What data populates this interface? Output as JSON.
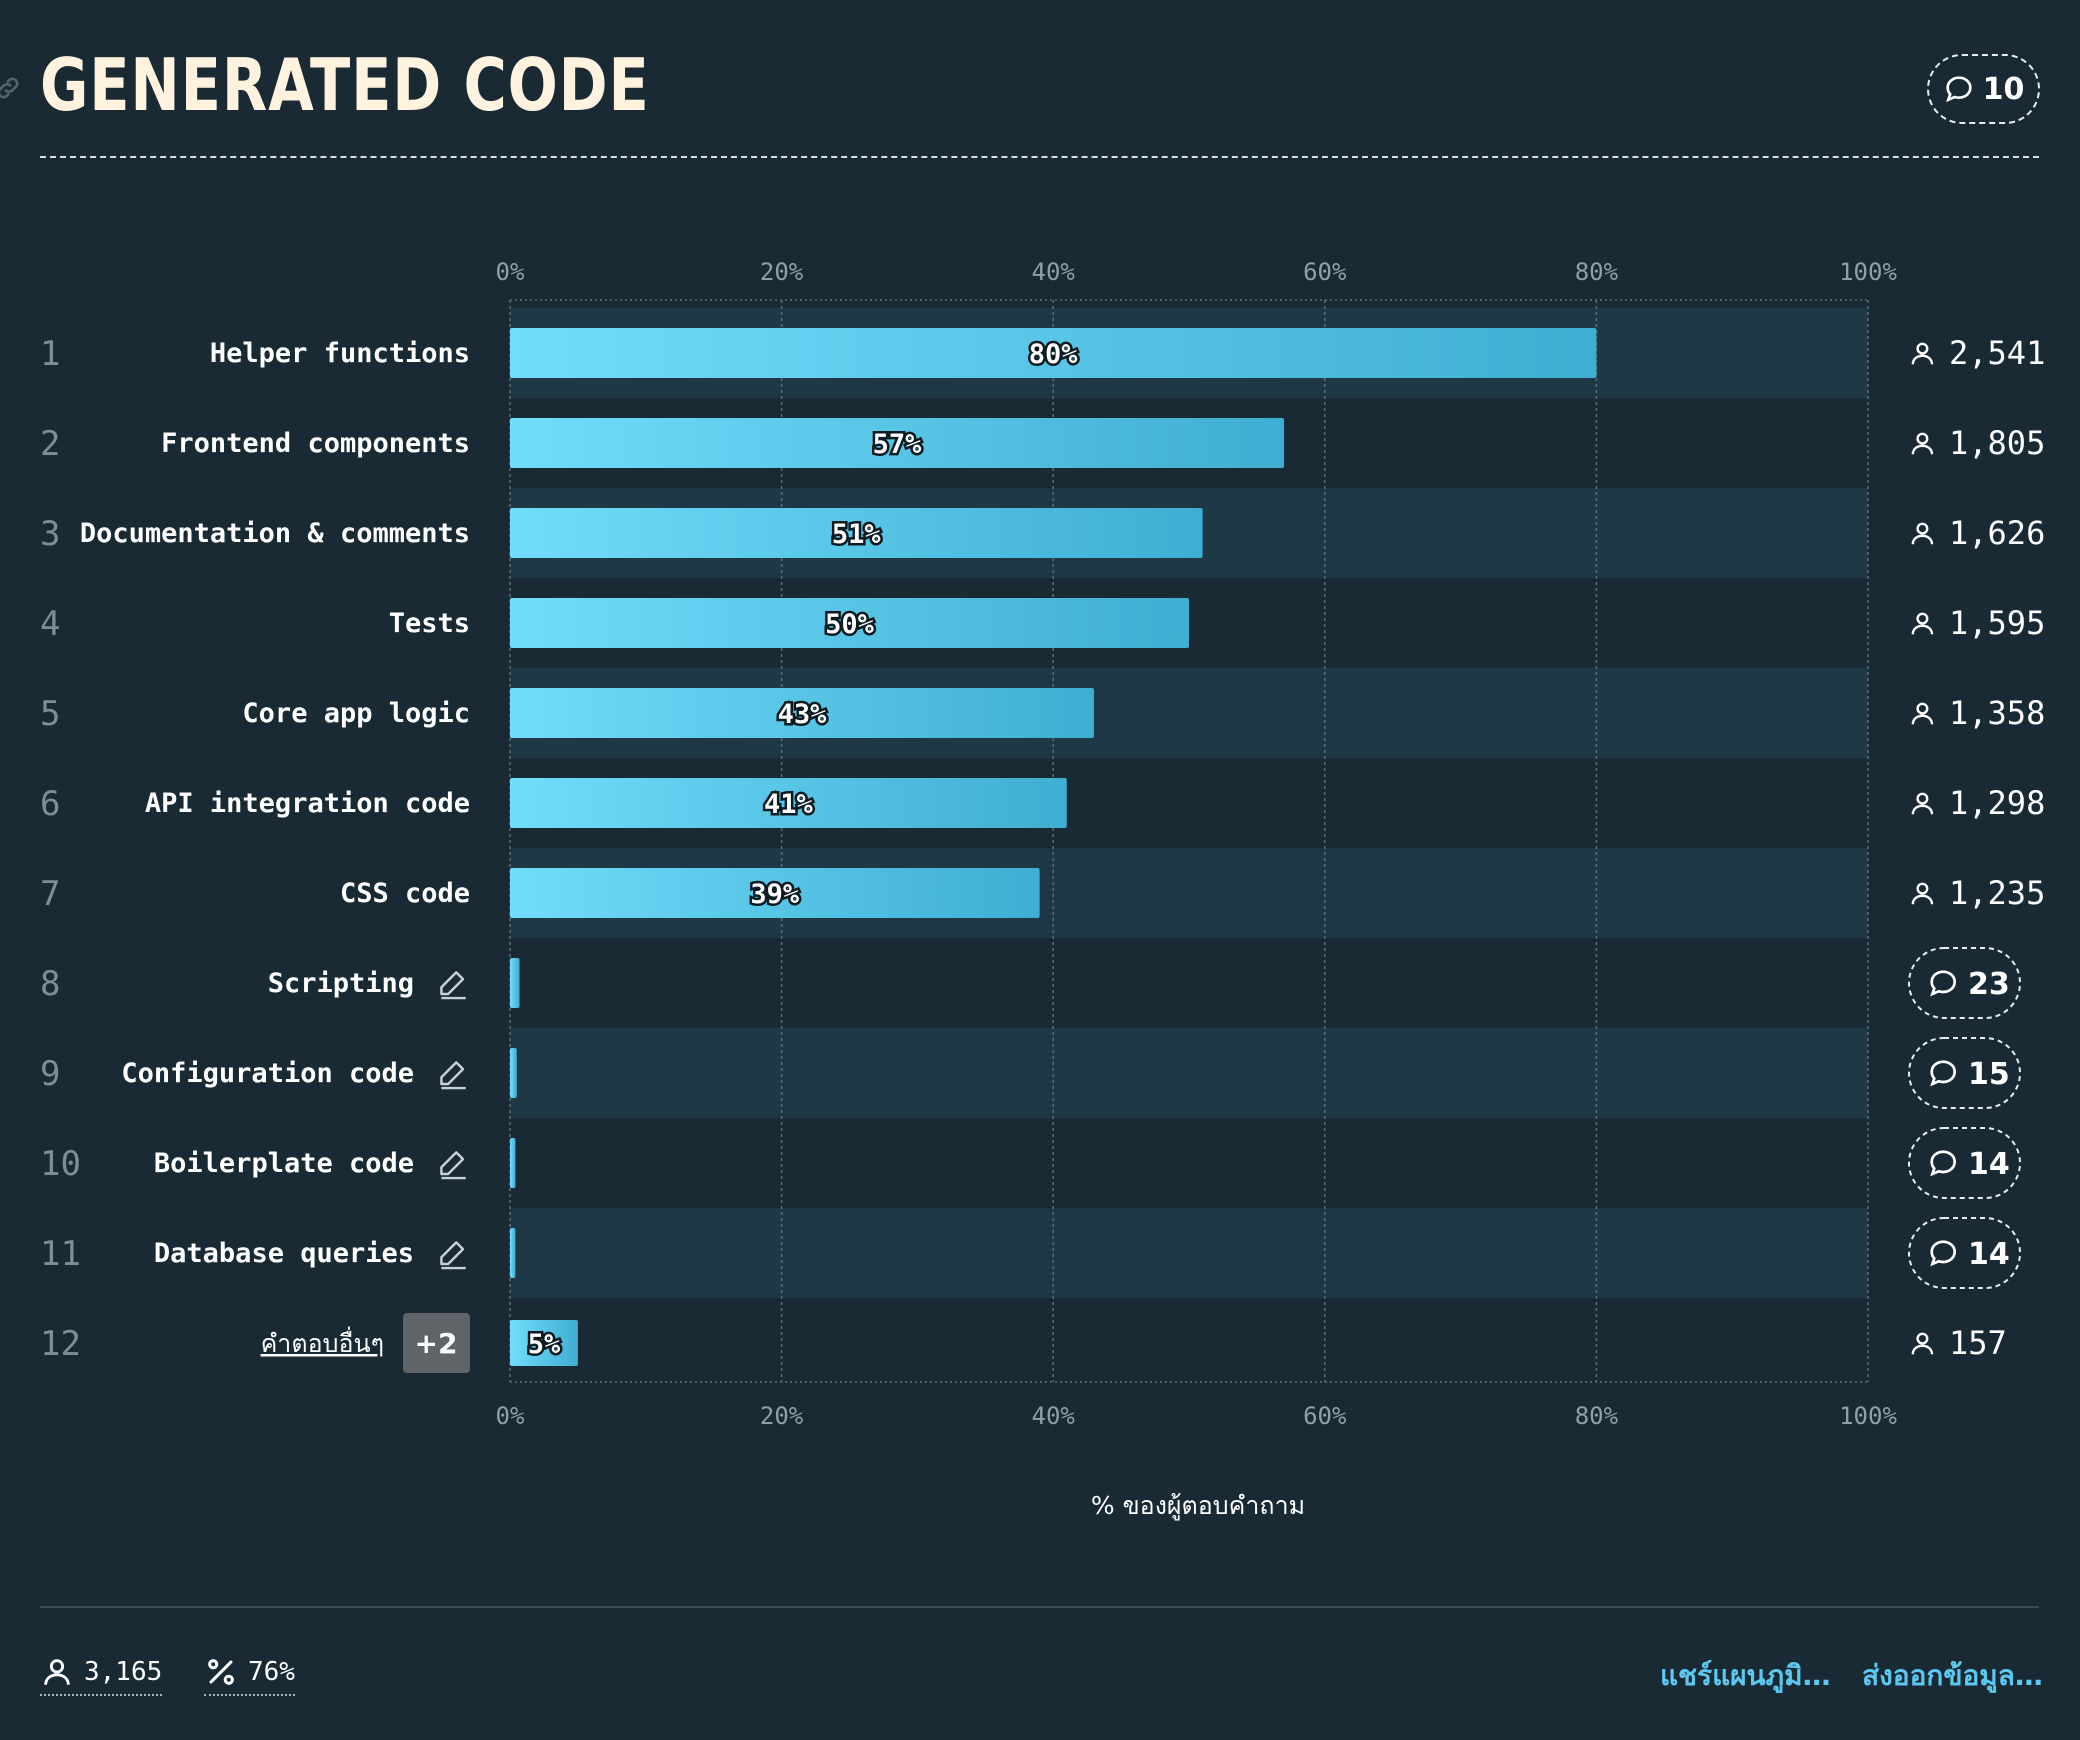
{
  "header": {
    "title": "GENERATED CODE",
    "comment_count": "10"
  },
  "footer": {
    "respondents": "3,165",
    "percent": "76%",
    "share_label": "แชร์แผนภูมิ…",
    "export_label": "ส่งออกข้อมูล…"
  },
  "colors": {
    "background": "#192a35",
    "bar_start": "#72dcfb",
    "bar_end": "#3eaed2",
    "link": "#5cc8f0"
  },
  "chart_data": {
    "type": "bar",
    "orientation": "horizontal",
    "categories": [
      "Helper functions",
      "Frontend components",
      "Documentation & comments",
      "Tests",
      "Core app logic",
      "API integration code",
      "CSS code",
      "Scripting",
      "Configuration code",
      "Boilerplate code",
      "Database queries",
      "คำตอบอื่นๆ"
    ],
    "values": [
      80,
      57,
      51,
      50,
      43,
      41,
      39,
      0.7,
      0.5,
      0.4,
      0.4,
      5
    ],
    "value_labels": [
      "80%",
      "57%",
      "51%",
      "50%",
      "43%",
      "41%",
      "39%",
      "",
      "",
      "",
      "",
      "5%"
    ],
    "respondent_counts": [
      "2,541",
      "1,805",
      "1,626",
      "1,595",
      "1,358",
      "1,298",
      "1,235",
      "",
      "",
      "",
      "",
      "157"
    ],
    "comment_counts": [
      "",
      "",
      "",
      "",
      "",
      "",
      "",
      "23",
      "15",
      "14",
      "14",
      ""
    ],
    "editable": [
      false,
      false,
      false,
      false,
      false,
      false,
      false,
      true,
      true,
      true,
      true,
      false
    ],
    "other_badge": "+2",
    "xlim": [
      0,
      100
    ],
    "xticks": [
      0,
      20,
      40,
      60,
      80,
      100
    ],
    "xtick_labels": [
      "0%",
      "20%",
      "40%",
      "60%",
      "80%",
      "100%"
    ],
    "xlabel": "% ของผู้ตอบคำถาม",
    "grid": true
  }
}
